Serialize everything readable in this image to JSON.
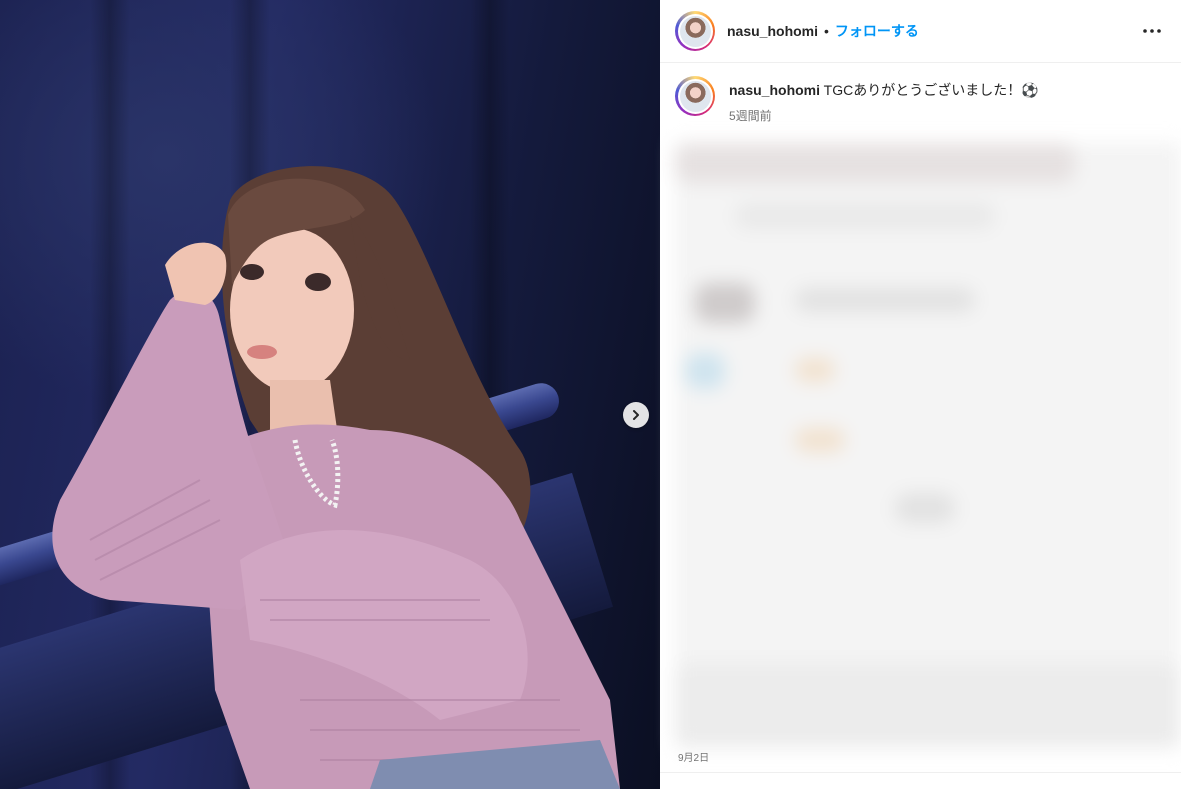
{
  "post": {
    "username": "nasu_hohomi",
    "separator": "•",
    "follow_label": "フォローする",
    "caption": "TGCありがとうございました！",
    "caption_emoji": "⚽",
    "time_ago": "5週間前",
    "date": "9月2日"
  },
  "icons": {
    "more": "more-horizontal-icon",
    "next": "chevron-right-icon"
  },
  "colors": {
    "accent": "#0095f6",
    "text": "#262626",
    "muted": "#737373"
  }
}
